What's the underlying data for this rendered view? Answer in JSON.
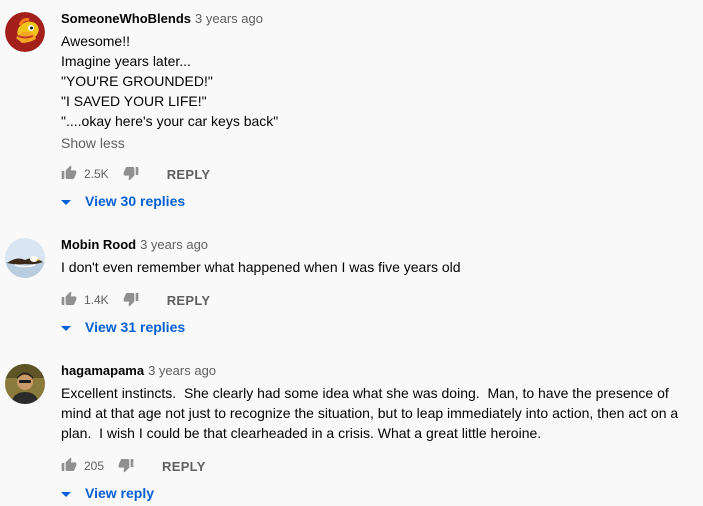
{
  "comments": [
    {
      "author": "SomeoneWhoBlends",
      "time": "3 years ago",
      "lines": [
        "Awesome!!",
        "Imagine years later...",
        "\"YOU'RE GROUNDED!\"",
        "\"I SAVED YOUR LIFE!\"",
        "\"....okay here's your car keys back\""
      ],
      "show_less": "Show less",
      "likes": "2.5K",
      "reply_label": "REPLY",
      "view_replies": "View 30 replies",
      "avatar_icon": "avatar-fire-character-icon"
    },
    {
      "author": "Mobin Rood",
      "time": "3 years ago",
      "lines": [
        "I don't even remember what happened when I was five years old"
      ],
      "likes": "1.4K",
      "reply_label": "REPLY",
      "view_replies": "View 31 replies",
      "avatar_icon": "avatar-eagle-icon"
    },
    {
      "author": "hagamapama",
      "time": "3 years ago",
      "text": "Excellent instincts.  She clearly had some idea what she was doing.  Man, to have the presence of mind at that age not just to recognize the situation, but to leap immediately into action, then act on a plan.  I wish I could be that clearheaded in a crisis. What a great little heroine.",
      "likes": "205",
      "reply_label": "REPLY",
      "view_replies": "View reply",
      "avatar_icon": "avatar-person-icon"
    }
  ],
  "colors": {
    "background": "#f9f9f9",
    "link_blue": "#065fd4",
    "secondary_text": "#606060",
    "icon": "#909090"
  }
}
